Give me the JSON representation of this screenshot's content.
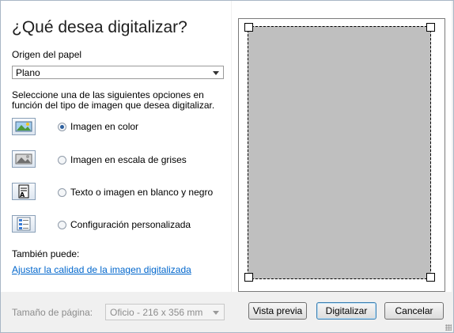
{
  "dialog": {
    "title": "¿Qué desea digitalizar?",
    "paper_source_label": "Origen del papel",
    "paper_source_value": "Plano",
    "instructions_line1": "Seleccione una de las siguientes opciones en",
    "instructions_line2": "función del tipo de imagen que desea digitalizar.",
    "options": [
      {
        "label": "Imagen en color",
        "selected": true,
        "icon": "color-image-icon"
      },
      {
        "label": "Imagen en escala de grises",
        "selected": false,
        "icon": "grayscale-image-icon"
      },
      {
        "label": "Texto o imagen en blanco y negro",
        "selected": false,
        "icon": "bw-text-icon"
      },
      {
        "label": "Configuración personalizada",
        "selected": false,
        "icon": "custom-settings-icon"
      }
    ],
    "also_label": "También puede:",
    "adjust_link": "Ajustar la calidad de la imagen digitalizada"
  },
  "footer": {
    "page_size_label": "Tamaño de página:",
    "page_size_value": "Oficio - 216 x 356 mm",
    "preview_button": "Vista previa",
    "scan_button": "Digitalizar",
    "cancel_button": "Cancelar"
  },
  "colors": {
    "link": "#0066cc",
    "scan_area": "#bfbfbf",
    "default_button_border": "#3c7fb1"
  }
}
